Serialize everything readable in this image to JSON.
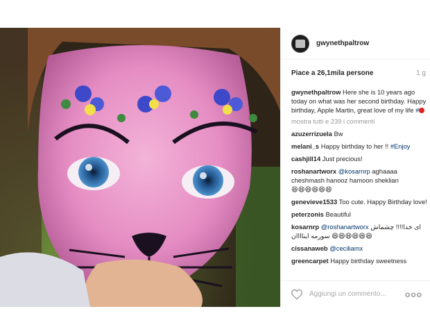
{
  "post": {
    "username": "gwynethpaltrow",
    "likes": "Piace a 26,1mila persone",
    "age": "1 g"
  },
  "caption": {
    "user": "gwynethpaltrow",
    "text": "Here she is 10 years ago today on what was her second birthday. Happy birthday, Apple Martin, great love of my life",
    "hashtag": "#"
  },
  "more_comments": "mostra tutti e 239 i commenti",
  "comments": [
    {
      "user": "azuzerrizuela",
      "text": "Bw"
    },
    {
      "user": "melani_s",
      "text": "Happy birthday to her !!",
      "mention": "#Enjoy"
    },
    {
      "user": "cashjill14",
      "text": "Just precious!"
    },
    {
      "user": "roshanartworx",
      "mention": "@kosarnrp",
      "text": "aghaaaa cheshmash hanooz hamoon sheklian",
      "emoji": "😆😆😆😆😆😆"
    },
    {
      "user": "genevieve1533",
      "text": "Too cute. Happy Birthday love!"
    },
    {
      "user": "peterzonis",
      "text": "Beautiful"
    },
    {
      "user": "kosarnrp",
      "mention": "@roshanartworx",
      "text": "ای خدا!!!! چشماش سورمه ایناااان",
      "emoji": "😆😆😆😆😆😆"
    },
    {
      "user": "cissanaweb",
      "mention": "@ceciliamx"
    },
    {
      "user": "greencarpet",
      "text": "Happy birthday sweetness"
    }
  ],
  "footer": {
    "placeholder": "Aggiungi un commento...",
    "more": "ooo"
  },
  "icons": {
    "like": "heart-outline-icon",
    "more": "more-options-icon"
  },
  "colors": {
    "link": "#003569",
    "muted": "#999999"
  }
}
